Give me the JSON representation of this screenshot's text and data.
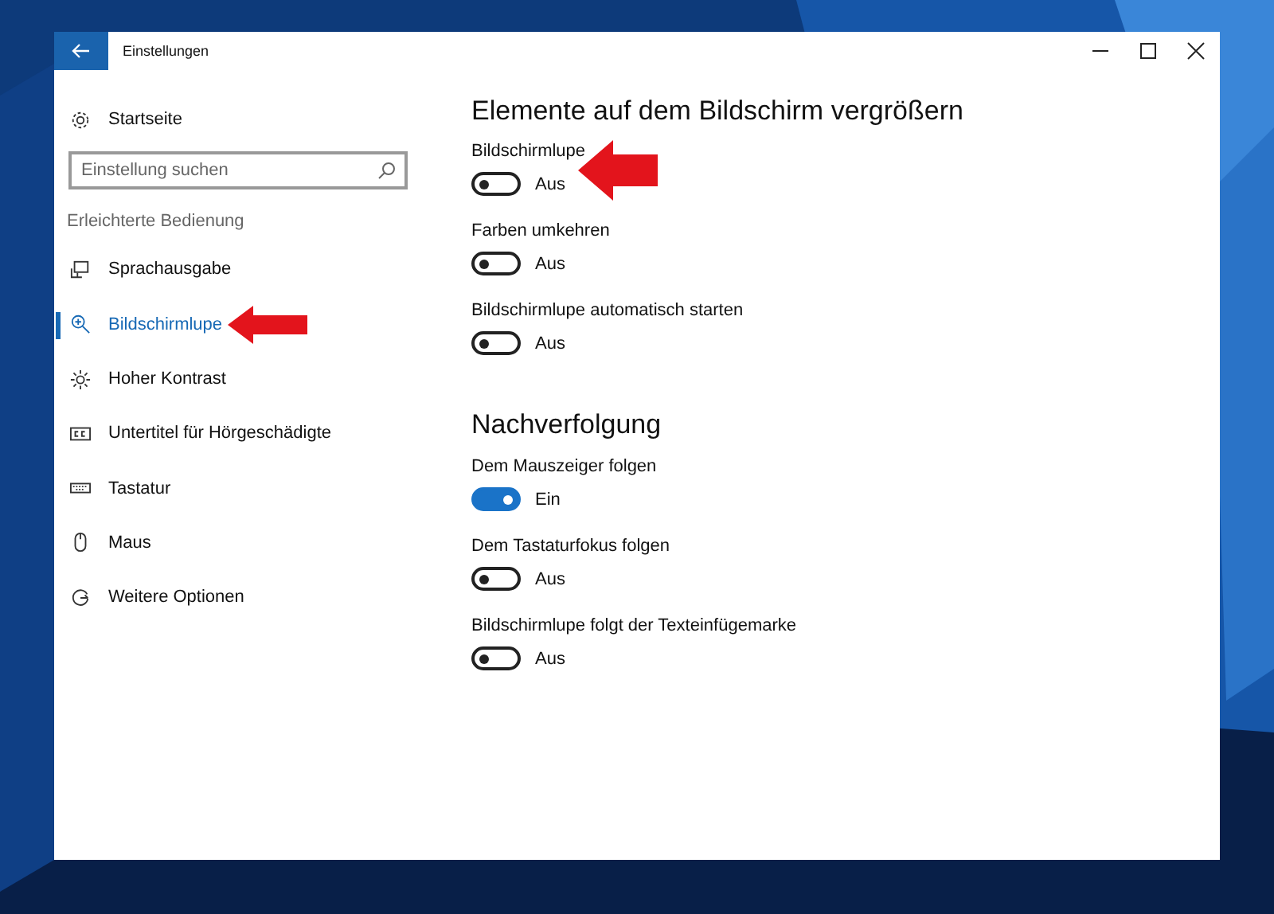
{
  "window": {
    "title": "Einstellungen"
  },
  "sidebar": {
    "home": "Startseite",
    "search": {
      "placeholder": "Einstellung suchen"
    },
    "section": "Erleichterte Bedienung",
    "items": [
      {
        "label": "Sprachausgabe",
        "kind": "narrator",
        "selected": false
      },
      {
        "label": "Bildschirmlupe",
        "kind": "magnifier",
        "selected": true
      },
      {
        "label": "Hoher Kontrast",
        "kind": "contrast",
        "selected": false
      },
      {
        "label": "Untertitel für Hörgeschädigte",
        "kind": "captions",
        "selected": false
      },
      {
        "label": "Tastatur",
        "kind": "keyboard",
        "selected": false
      },
      {
        "label": "Maus",
        "kind": "mouse",
        "selected": false
      },
      {
        "label": "Weitere Optionen",
        "kind": "more",
        "selected": false
      }
    ]
  },
  "sections": [
    {
      "title": "Elemente auf dem Bildschirm vergrößern",
      "settings": [
        {
          "label": "Bildschirmlupe",
          "on": false,
          "state": "Aus"
        },
        {
          "label": "Farben umkehren",
          "on": false,
          "state": "Aus"
        },
        {
          "label": "Bildschirmlupe automatisch starten",
          "on": false,
          "state": "Aus"
        }
      ]
    },
    {
      "title": "Nachverfolgung",
      "settings": [
        {
          "label": "Dem Mauszeiger folgen",
          "on": true,
          "state": "Ein"
        },
        {
          "label": "Dem Tastaturfokus folgen",
          "on": false,
          "state": "Aus"
        },
        {
          "label": "Bildschirmlupe folgt der Texteinfügemarke",
          "on": false,
          "state": "Aus"
        }
      ]
    }
  ]
}
